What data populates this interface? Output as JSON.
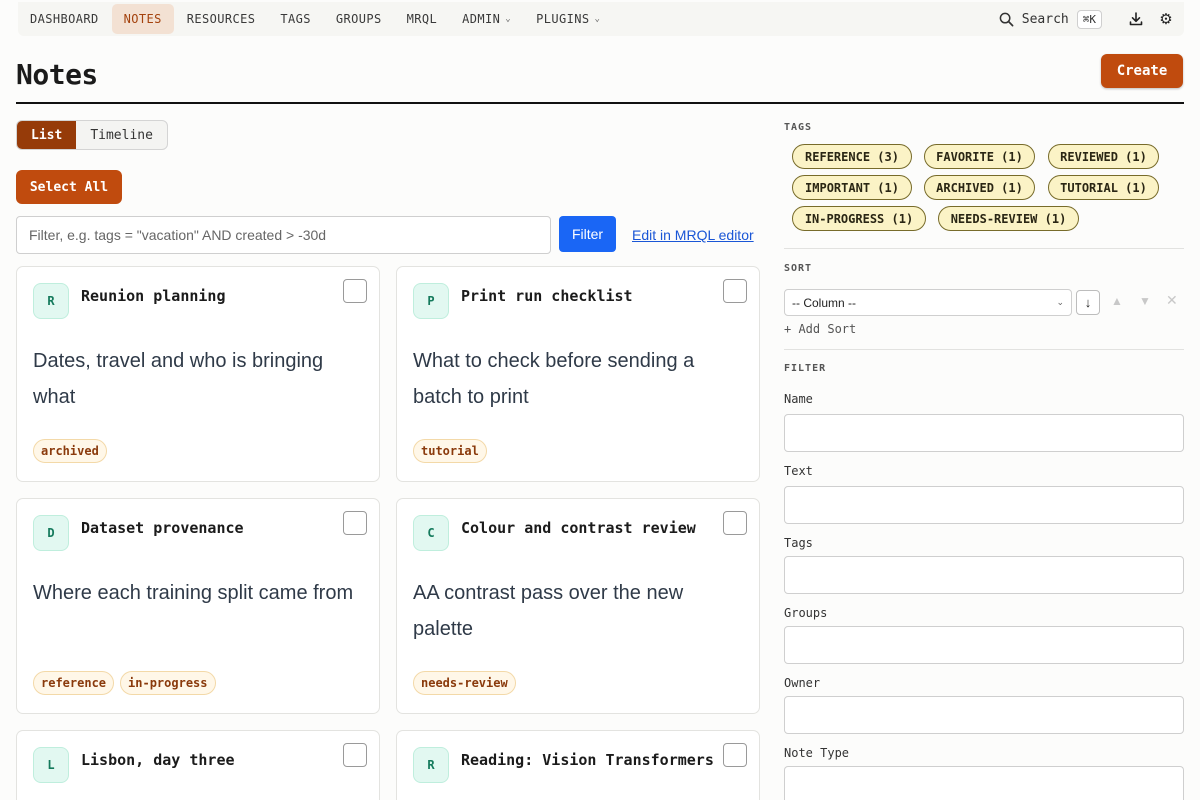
{
  "nav": {
    "items": [
      {
        "label": "DASHBOARD",
        "active": false,
        "dropdown": false
      },
      {
        "label": "NOTES",
        "active": true,
        "dropdown": false
      },
      {
        "label": "RESOURCES",
        "active": false,
        "dropdown": false
      },
      {
        "label": "TAGS",
        "active": false,
        "dropdown": false
      },
      {
        "label": "GROUPS",
        "active": false,
        "dropdown": false
      },
      {
        "label": "MRQL",
        "active": false,
        "dropdown": false
      },
      {
        "label": "ADMIN",
        "active": false,
        "dropdown": true
      },
      {
        "label": "PLUGINS",
        "active": false,
        "dropdown": true
      }
    ],
    "search_label": "Search",
    "search_shortcut": "⌘K",
    "icons": [
      "search-icon",
      "download-icon",
      "gear-icon"
    ]
  },
  "page": {
    "title": "Notes",
    "create_label": "Create"
  },
  "view_toggle": {
    "options": [
      "List",
      "Timeline"
    ],
    "selected": "List"
  },
  "select_all_label": "Select All",
  "filter": {
    "placeholder": "Filter, e.g. tags = \"vacation\" AND created > -30d",
    "button_label": "Filter",
    "editor_link": "Edit in MRQL editor"
  },
  "notes": [
    {
      "initial": "R",
      "title": "Reunion planning",
      "description": "Dates, travel and who is bringing what",
      "tags": [
        "archived"
      ]
    },
    {
      "initial": "P",
      "title": "Print run checklist",
      "description": "What to check before sending a batch to print",
      "tags": [
        "tutorial"
      ]
    },
    {
      "initial": "D",
      "title": "Dataset provenance",
      "description": "Where each training split came from",
      "tags": [
        "reference",
        "in-progress"
      ]
    },
    {
      "initial": "C",
      "title": "Colour and contrast review",
      "description": "AA contrast pass over the new palette",
      "tags": [
        "needs-review"
      ]
    },
    {
      "initial": "L",
      "title": "Lisbon, day three",
      "description": "",
      "tags": []
    },
    {
      "initial": "R",
      "title": "Reading: Vision Transformers",
      "description": "",
      "tags": []
    }
  ],
  "sidebar": {
    "tags_heading": "TAGS",
    "tag_pills": [
      "REFERENCE (3)",
      "FAVORITE (1)",
      "REVIEWED (1)",
      "IMPORTANT (1)",
      "ARCHIVED (1)",
      "TUTORIAL (1)",
      "IN-PROGRESS (1)",
      "NEEDS-REVIEW (1)"
    ],
    "sort_heading": "SORT",
    "sort_column": "-- Column --",
    "sort_direction": "↓",
    "add_sort_label": "+ Add Sort",
    "filter_heading": "FILTER",
    "filter_fields": [
      "Name",
      "Text",
      "Tags",
      "Groups",
      "Owner",
      "Note Type"
    ]
  },
  "colors": {
    "accent": "#c04b0e",
    "accent_dark": "#963b09",
    "link": "#1a56d6",
    "filter_button": "#1a66f5"
  }
}
